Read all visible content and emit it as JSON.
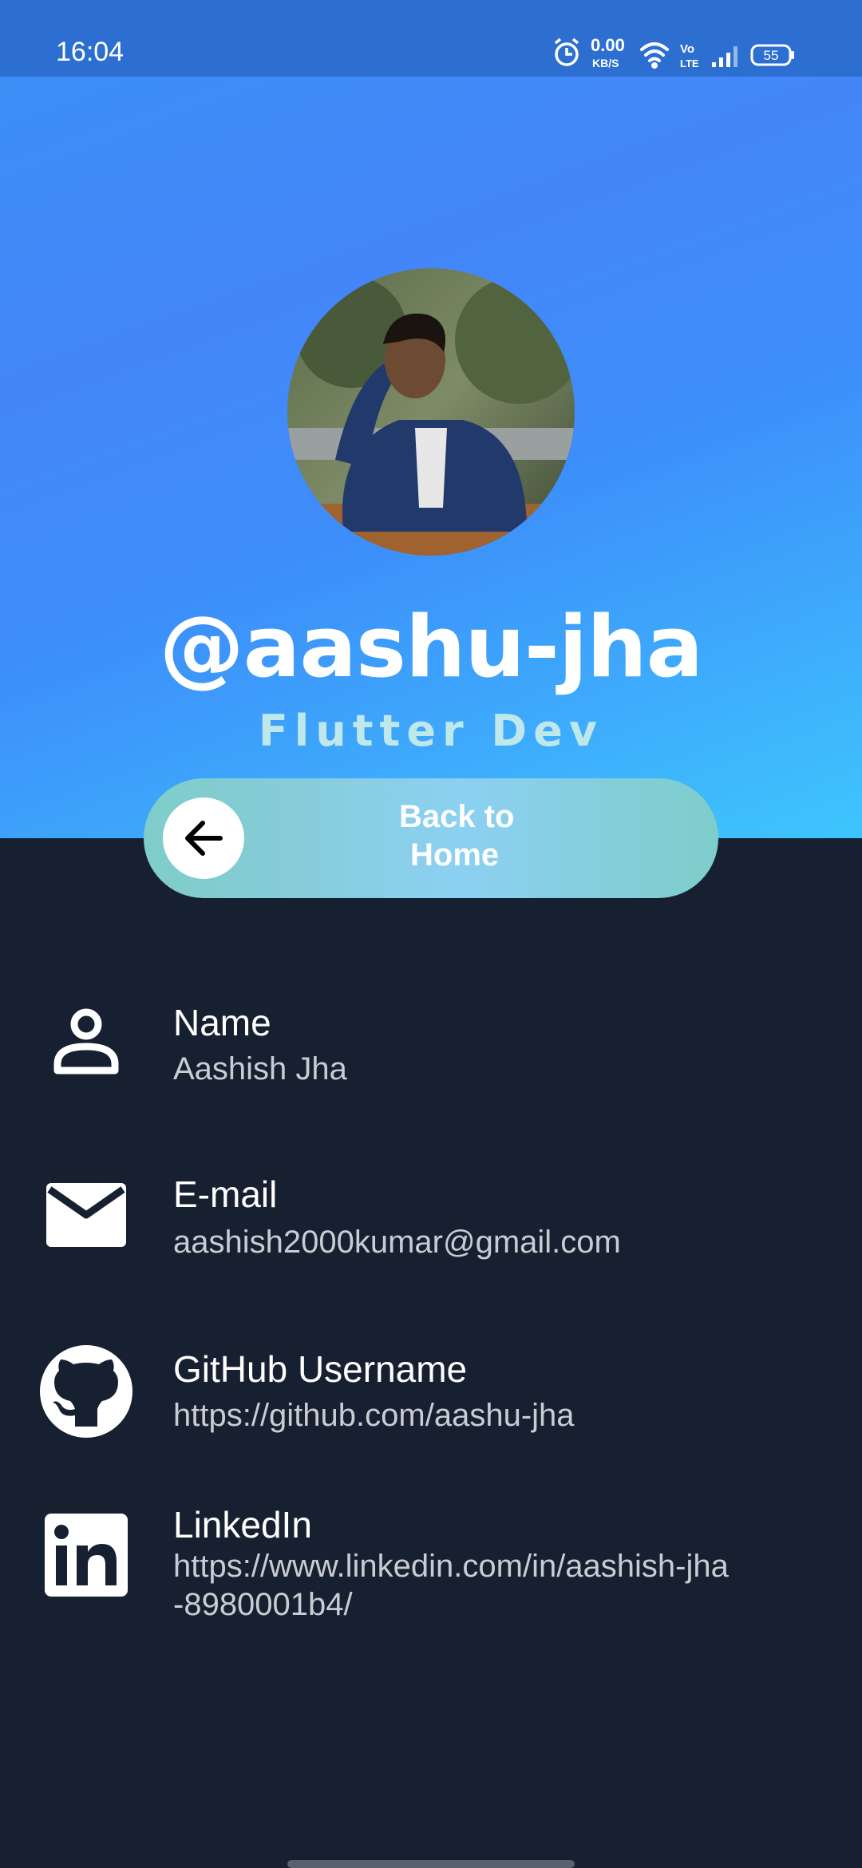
{
  "status_bar": {
    "time": "16:04",
    "data_speed": "0.00",
    "data_unit": "KB/S",
    "volte": "Vo LTE",
    "battery": "55",
    "icons": [
      "alarm-icon",
      "wifi-icon",
      "volte-icon",
      "signal-icon",
      "battery-icon"
    ]
  },
  "profile": {
    "handle": "@aashu-jha",
    "role": "Flutter Dev",
    "avatar": "profile-photo"
  },
  "back_button": {
    "label_line1": "Back to",
    "label_line2": "Home",
    "icon": "arrow-left-icon"
  },
  "info": [
    {
      "icon": "person-icon",
      "title": "Name",
      "value": "Aashish Jha"
    },
    {
      "icon": "mail-icon",
      "title": "E-mail",
      "value": "aashish2000kumar@gmail.com"
    },
    {
      "icon": "github-icon",
      "title": "GitHub Username",
      "value": "https://github.com/aashu-jha"
    },
    {
      "icon": "linkedin-icon",
      "title": "LinkedIn",
      "value_line1": "https://www.linkedin.com/in/aashish-jha",
      "value_line2": "-8980001b4/"
    }
  ],
  "colors": {
    "header_gradient_start": "#4486fa",
    "header_gradient_end": "#3ec5fd",
    "body_background": "#172030",
    "role_text": "#bfe8ea",
    "button_teal": "#7ecdca"
  }
}
